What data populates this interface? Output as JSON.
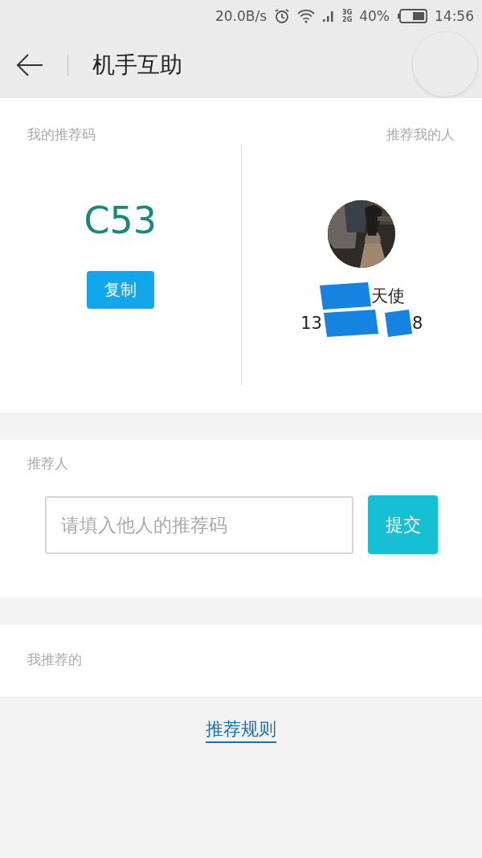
{
  "status_bar": {
    "speed": "20.0B/s",
    "network_top": "3G",
    "network_bottom": "2G",
    "battery": "40%",
    "time": "14:56"
  },
  "header": {
    "title": "机手互助"
  },
  "my_code": {
    "label": "我的推荐码",
    "code": "C53",
    "copy_button": "复制"
  },
  "referrer": {
    "label": "推荐我的人",
    "name": "天使",
    "phone_start": "13",
    "phone_end": "8"
  },
  "recommend": {
    "label": "推荐人",
    "placeholder": "请填入他人的推荐码",
    "submit_button": "提交"
  },
  "my_referrals": {
    "label": "我推荐的"
  },
  "rules_link": "推荐规则"
}
